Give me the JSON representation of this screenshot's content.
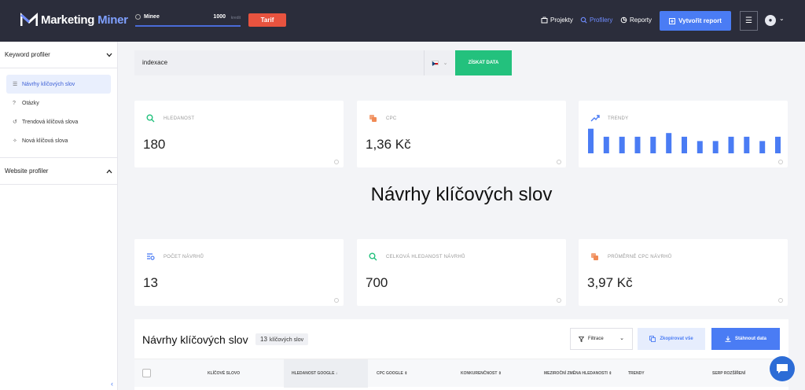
{
  "app": {
    "logo_word1": "Marketing",
    "logo_word2": "Miner"
  },
  "topbar": {
    "credits_label": "Minee",
    "credits_value": "1000",
    "credits_unit": "kredit",
    "tarif_label": "Tarif",
    "nav": [
      {
        "label": "Projekty",
        "icon": "briefcase-icon"
      },
      {
        "label": "Profilery",
        "icon": "search-icon"
      },
      {
        "label": "Reporty",
        "icon": "pie-icon"
      }
    ],
    "create_label": "Vytvořit report",
    "menu_icon": "☰",
    "avatar_icon": "user-icon"
  },
  "sidebar": {
    "section1": "Keyword profiler",
    "items": [
      {
        "label": "Návrhy klíčových slov",
        "icon": "list-icon"
      },
      {
        "label": "Otázky",
        "icon": "question-icon"
      },
      {
        "label": "Trendová klíčová slova",
        "icon": "trend-icon"
      },
      {
        "label": "Nová klíčová slova",
        "icon": "new-icon"
      }
    ],
    "section2": "Website profiler"
  },
  "search": {
    "value": "indexace",
    "country": "CZ",
    "button_label": "ZÍSKAT DATA"
  },
  "cards_top": [
    {
      "label": "HLEDANOST",
      "value": "180",
      "icon": "search-icon"
    },
    {
      "label": "CPC",
      "value": "1,36 Kč",
      "icon": "coins-icon"
    },
    {
      "label": "TRENDY",
      "icon": "trend-icon"
    }
  ],
  "trend_bars": [
    0.92,
    0.62,
    0.62,
    0.62,
    0.62,
    0.76,
    0.62,
    0.46,
    0.46,
    0.62,
    0.62,
    0.46,
    0.62
  ],
  "page_title": "Návrhy klíčových slov",
  "cards_bottom": [
    {
      "label": "POČET NÁVRHŮ",
      "value": "13",
      "icon": "list-search-icon"
    },
    {
      "label": "CELKOVÁ HLEDANOST NÁVRHŮ",
      "value": "700",
      "icon": "search-icon"
    },
    {
      "label": "PRŮMĚRNÉ CPC NÁVRHŮ",
      "value": "3,97 Kč",
      "icon": "coins-icon"
    }
  ],
  "table": {
    "title": "Návrhy klíčových slov",
    "count": "13",
    "count_label": "klíčových slov",
    "filter_label": "Filtrace",
    "copy_label": "Zkopírovat vše",
    "download_label": "Stáhnout data",
    "columns": [
      {
        "label": "KLÍČOVÉ SLOVO"
      },
      {
        "label": "HLEDANOST GOOGLE ↓"
      },
      {
        "label": "CPC GOOGLE ⇕"
      },
      {
        "label": "KONKURENČNOST ⇕"
      },
      {
        "label": "MEZIROČNÍ ZMĚNA HLEDANOSTI ⇕"
      },
      {
        "label": "TRENDY"
      },
      {
        "label": "SERP ROZŠÍŘENÍ"
      }
    ]
  },
  "colors": {
    "topbar": "#2b2d3b",
    "accent": "#4a7cf4",
    "green": "#23c17d",
    "tarif": "#e8533f"
  }
}
